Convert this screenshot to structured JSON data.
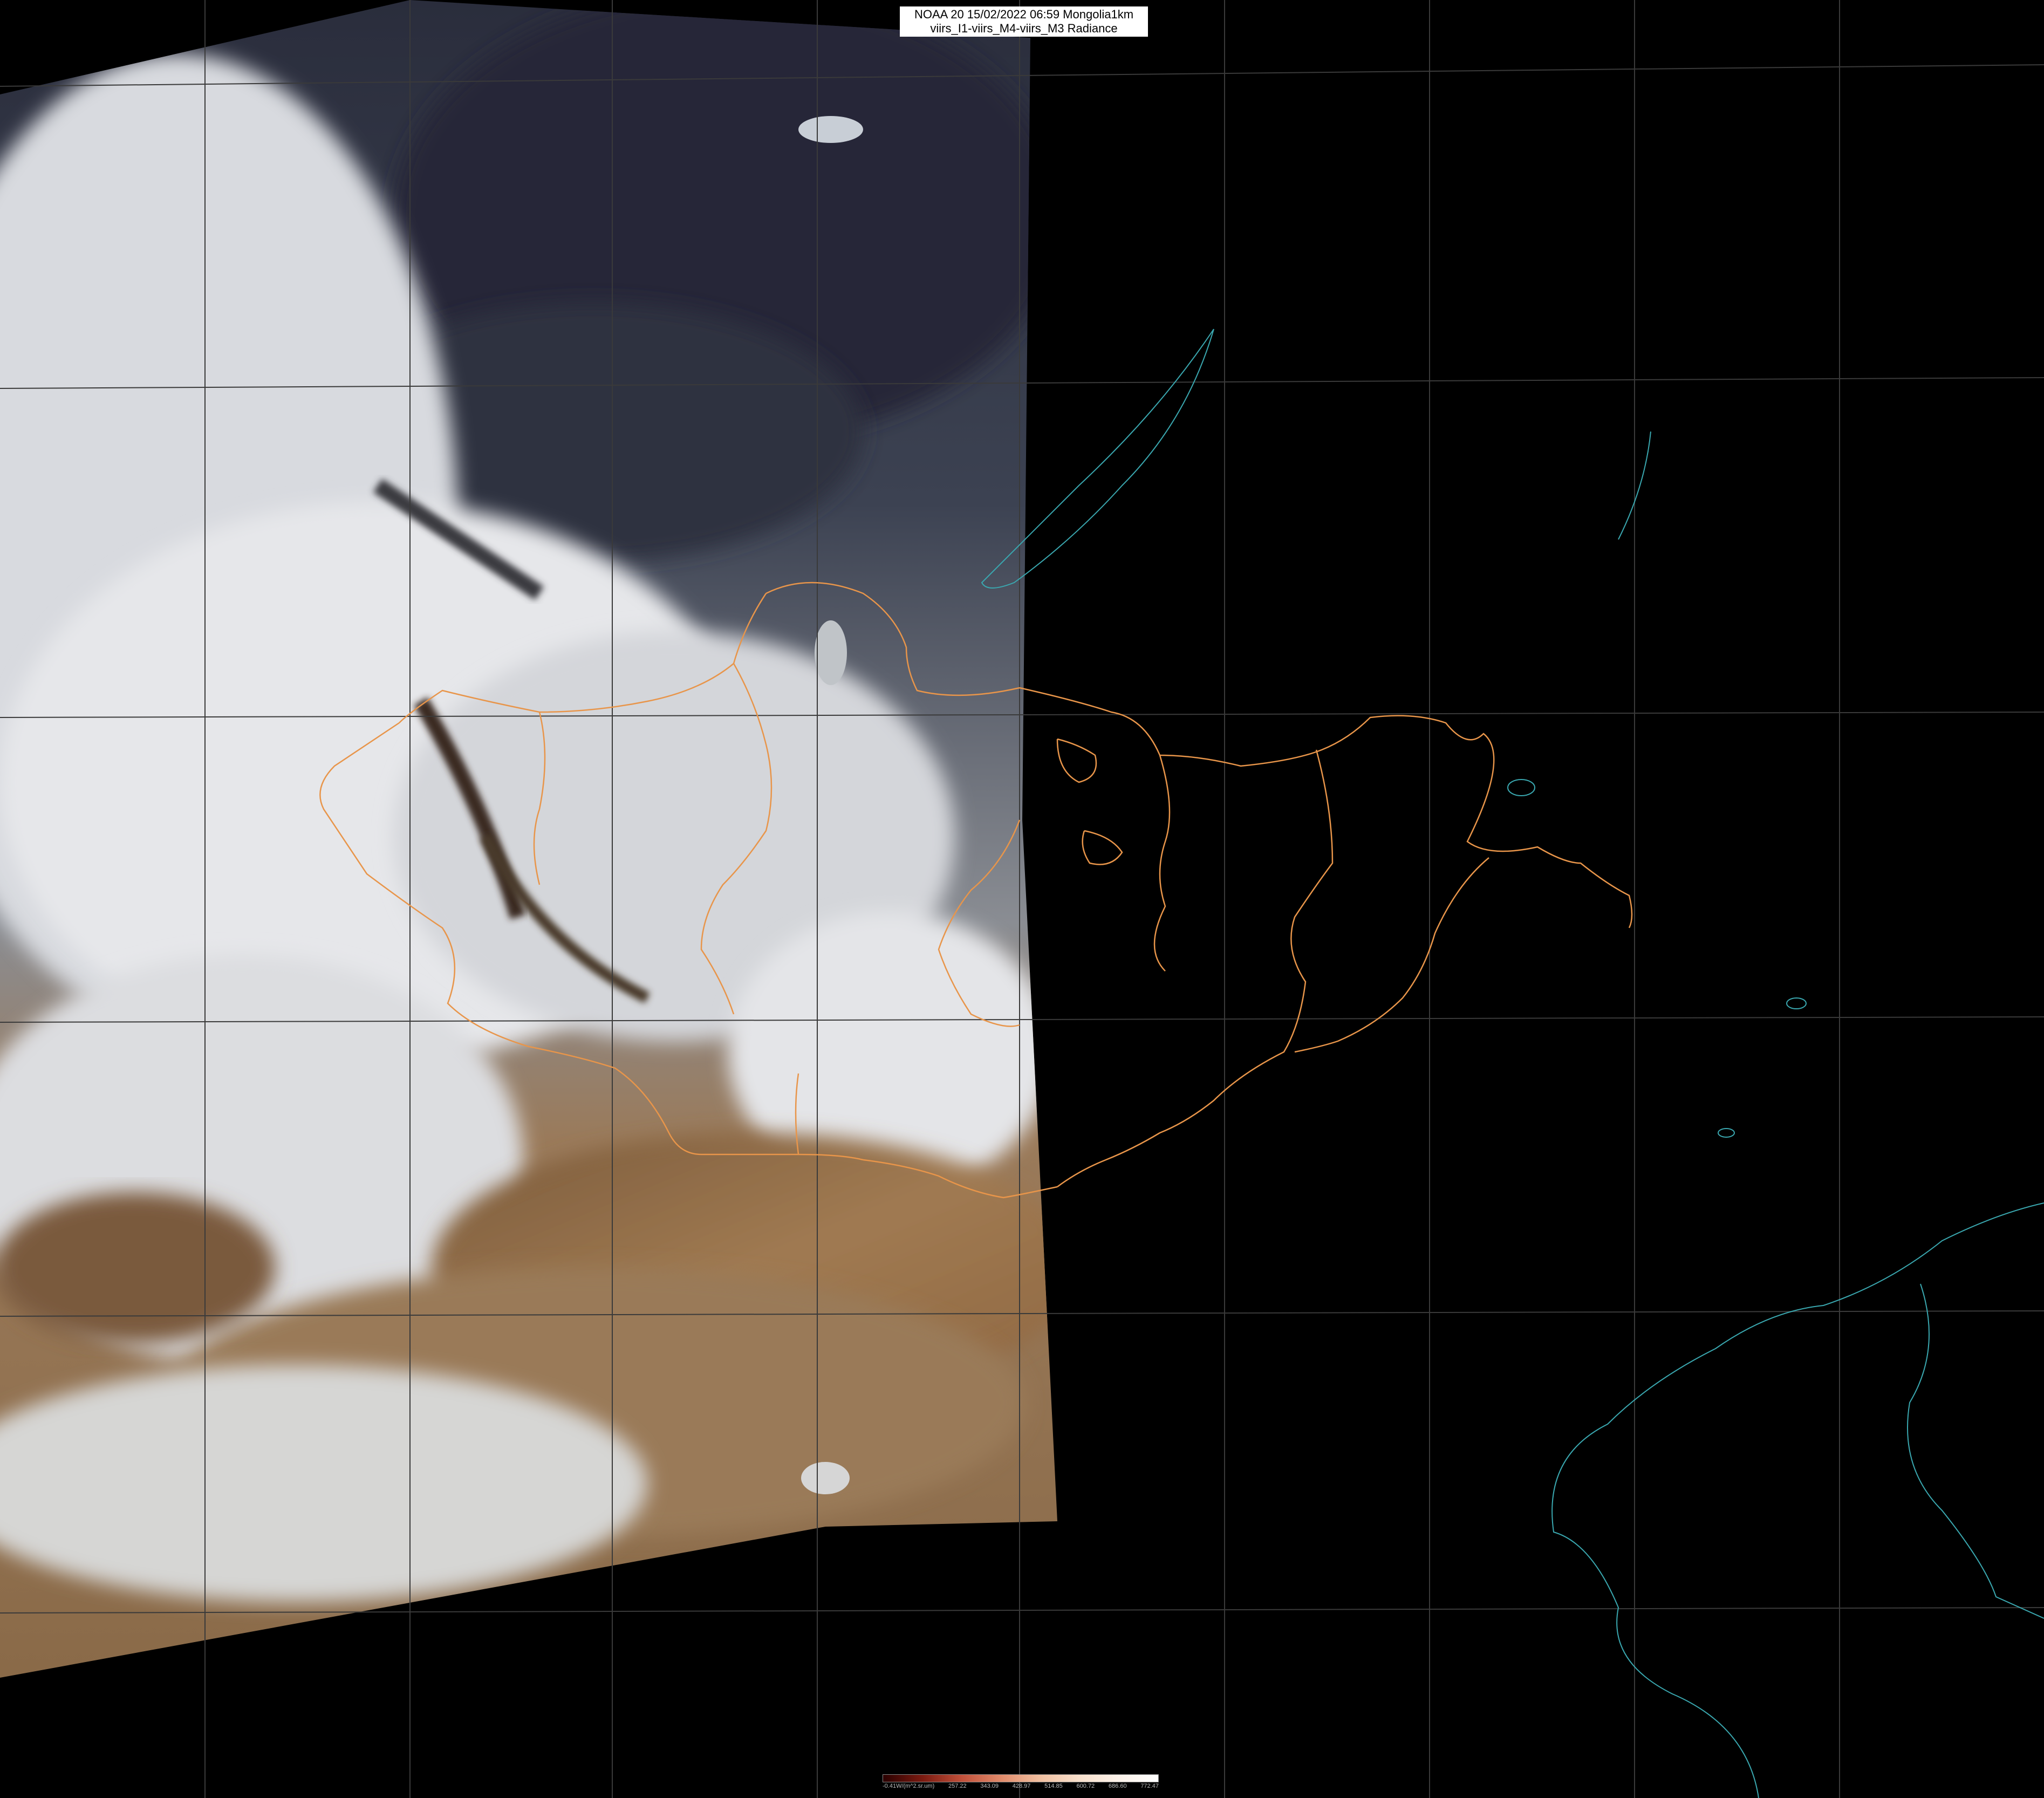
{
  "header": {
    "line1": "NOAA 20 15/02/2022 06:59 Mongolia1km",
    "line2": "viirs_I1-viirs_M4-viirs_M3 Radiance"
  },
  "legend": {
    "ticks": [
      "-0.41W/(m^2.sr.um)",
      "257.22",
      "343.09",
      "428.97",
      "514.85",
      "600.72",
      "686.60",
      "772.47"
    ],
    "colors": [
      "#2a0000",
      "#7a1a10",
      "#c0503a",
      "#e08a6a",
      "#f0bfa0",
      "#f8e0cc",
      "#fcf2ea",
      "#ffffff"
    ]
  },
  "colors": {
    "background": "#000000",
    "border_orange": "#e8954a",
    "coast_cyan": "#3aa8b0",
    "grid": "#3a3a3a"
  }
}
